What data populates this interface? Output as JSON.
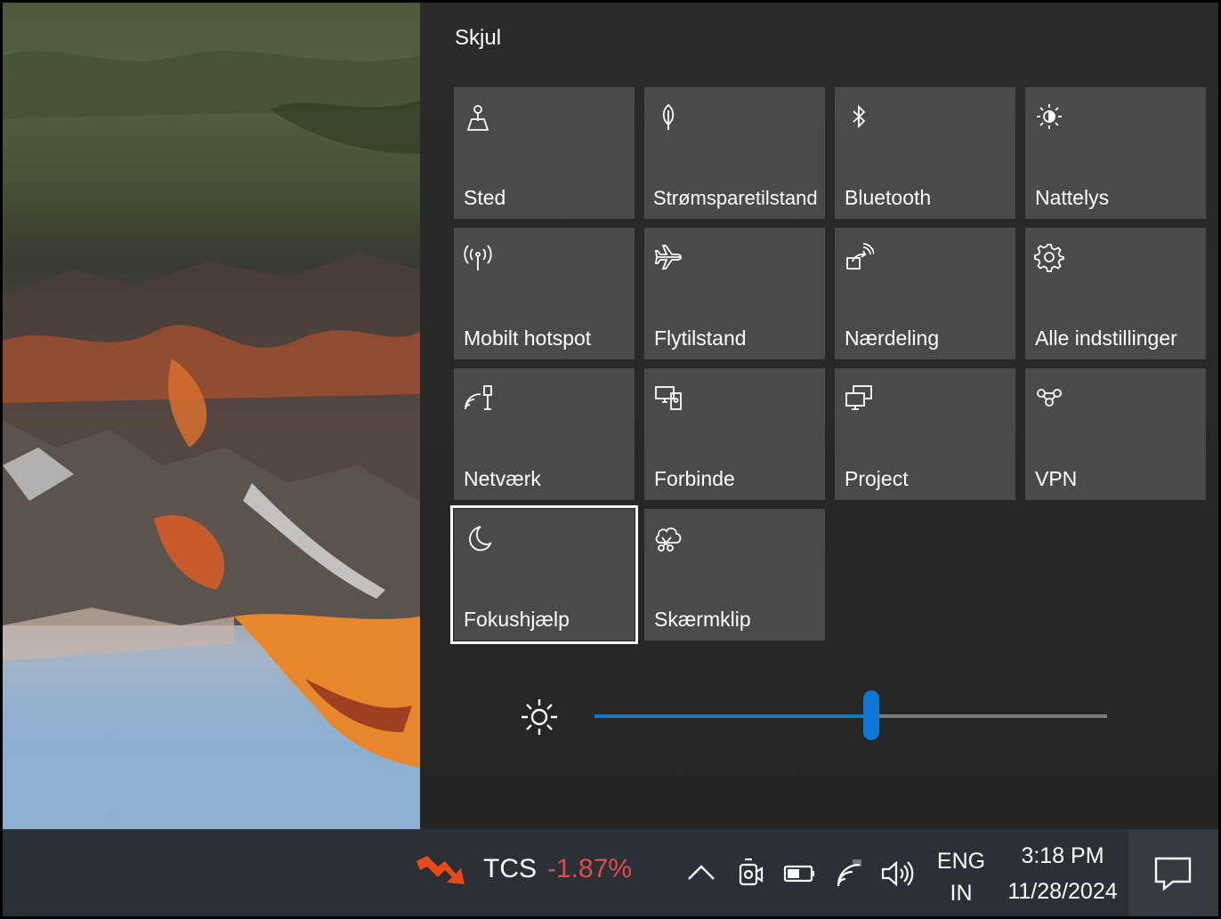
{
  "action_center": {
    "collapse_label": "Skjul",
    "tiles": [
      {
        "label": "Sted",
        "icon": "location-icon"
      },
      {
        "label": "Strømsparetilstand",
        "icon": "battery-saver-icon"
      },
      {
        "label": "Bluetooth",
        "icon": "bluetooth-icon"
      },
      {
        "label": "Nattelys",
        "icon": "night-light-icon"
      },
      {
        "label": "Mobilt hotspot",
        "icon": "hotspot-icon"
      },
      {
        "label": "Flytilstand",
        "icon": "airplane-icon"
      },
      {
        "label": "Nærdeling",
        "icon": "nearby-share-icon"
      },
      {
        "label": "Alle indstillinger",
        "icon": "gear-icon"
      },
      {
        "label": "Netværk",
        "icon": "network-icon"
      },
      {
        "label": "Forbinde",
        "icon": "connect-icon"
      },
      {
        "label": "Project",
        "icon": "project-icon"
      },
      {
        "label": "VPN",
        "icon": "vpn-icon"
      },
      {
        "label": "Fokushjælp",
        "icon": "moon-icon"
      },
      {
        "label": "Skærmklip",
        "icon": "snip-icon"
      }
    ],
    "focused_tile": "Fokushjælp",
    "brightness_level": 0.54,
    "colors": {
      "tile": "#4a4a4a",
      "accent": "#0a78d4"
    }
  },
  "taskbar": {
    "stock_symbol": "TCS",
    "stock_change": "-1.87%",
    "stock_change_color": "#e34a4a",
    "language_line1": "ENG",
    "language_line2": "IN",
    "time": "3:18 PM",
    "date": "11/28/2024",
    "tray_icons": [
      "chevron-up-icon",
      "meet-now-icon",
      "battery-icon",
      "wifi-icon",
      "volume-icon"
    ]
  }
}
